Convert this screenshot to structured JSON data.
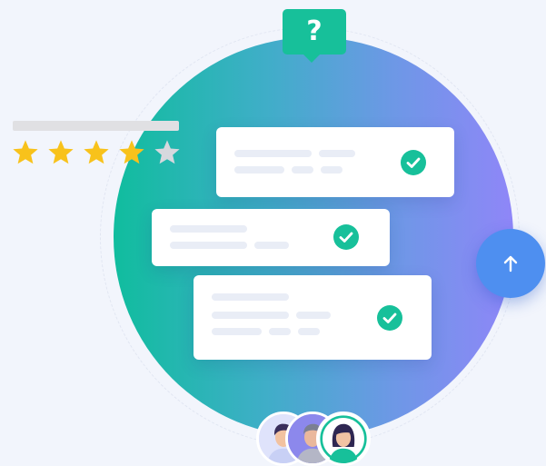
{
  "bubble": {
    "symbol": "?",
    "icon": "question-icon"
  },
  "rating": {
    "value": 4,
    "max": 5,
    "colors": {
      "filled": "#f8c21b",
      "empty": "#d6d8de"
    }
  },
  "cards": [
    {
      "checked": true,
      "lines": 2
    },
    {
      "checked": true,
      "lines": 2
    },
    {
      "checked": true,
      "lines": 3
    }
  ],
  "upload": {
    "icon": "arrow-up-icon"
  },
  "avatars": [
    "avatar-man",
    "avatar-man-gray",
    "avatar-woman"
  ],
  "colors": {
    "accent": "#17c09a",
    "check": "#17c09a",
    "button": "#4e8ff0",
    "gradient_start": "#10bd9e",
    "gradient_end": "#8f86f8"
  }
}
